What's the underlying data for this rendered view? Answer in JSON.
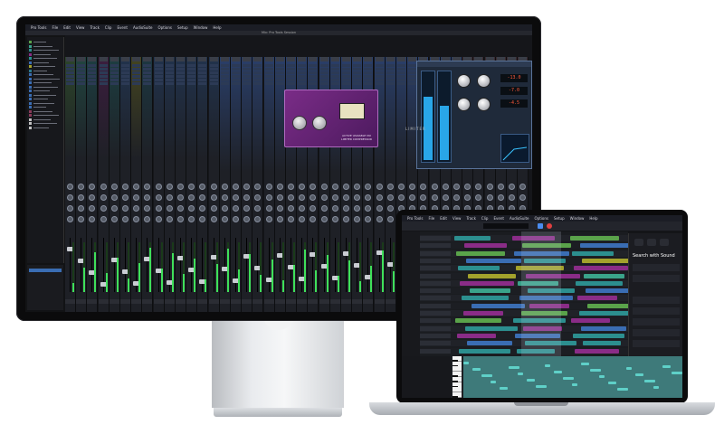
{
  "monitor": {
    "menu": [
      "Pro Tools",
      "File",
      "Edit",
      "View",
      "Track",
      "Clip",
      "Event",
      "AudioSuite",
      "Options",
      "Setup",
      "Window",
      "Help"
    ],
    "window_title": "Mix: Pro Tools Session",
    "strip_colors": [
      "#5aa34a",
      "#3aa38a",
      "#2c8f8f",
      "#8a2c87",
      "#2c8f8f",
      "#3a6db3",
      "#a3a22c",
      "#2c7a8f",
      "#3a6db3",
      "#3a6db3",
      "#3a6db3",
      "#3a6db3",
      "#3a6db3",
      "#3a6db3",
      "#3a6db3",
      "#3a6db3",
      "#3a6db3",
      "#8a3a5a",
      "#8a3a5a",
      "#c0c0c0",
      "#c0c0c0",
      "#c0c0c0"
    ],
    "plugin_purple_label": "ACTIVE VARIABLE MU LIMITER COMPRESSOR",
    "plugin_blue_readouts": [
      "-13.0",
      "-7.0",
      "-4.5"
    ],
    "plugin_blue_label": "LIMITER"
  },
  "laptop": {
    "menu": [
      "Pro Tools",
      "File",
      "Edit",
      "View",
      "Track",
      "Clip",
      "Event",
      "AudioSuite",
      "Options",
      "Setup",
      "Window",
      "Help"
    ],
    "panel_title": "Search with Sound",
    "track_colors": [
      "#2c8f8f",
      "#8a2c87",
      "#5aa34a",
      "#3a6db3",
      "#2c8f8f",
      "#a3a22c",
      "#8a2c87",
      "#3aa38a",
      "#2c8f8f",
      "#3a6db3",
      "#8a2c87",
      "#5aa34a",
      "#2c8f8f",
      "#8a2c87",
      "#3a6db3",
      "#2c8f8f"
    ]
  },
  "colors": {
    "accent_teal": "#5fd0c8",
    "accent_purple": "#8a2c87",
    "meter_green": "#3fe05a"
  }
}
